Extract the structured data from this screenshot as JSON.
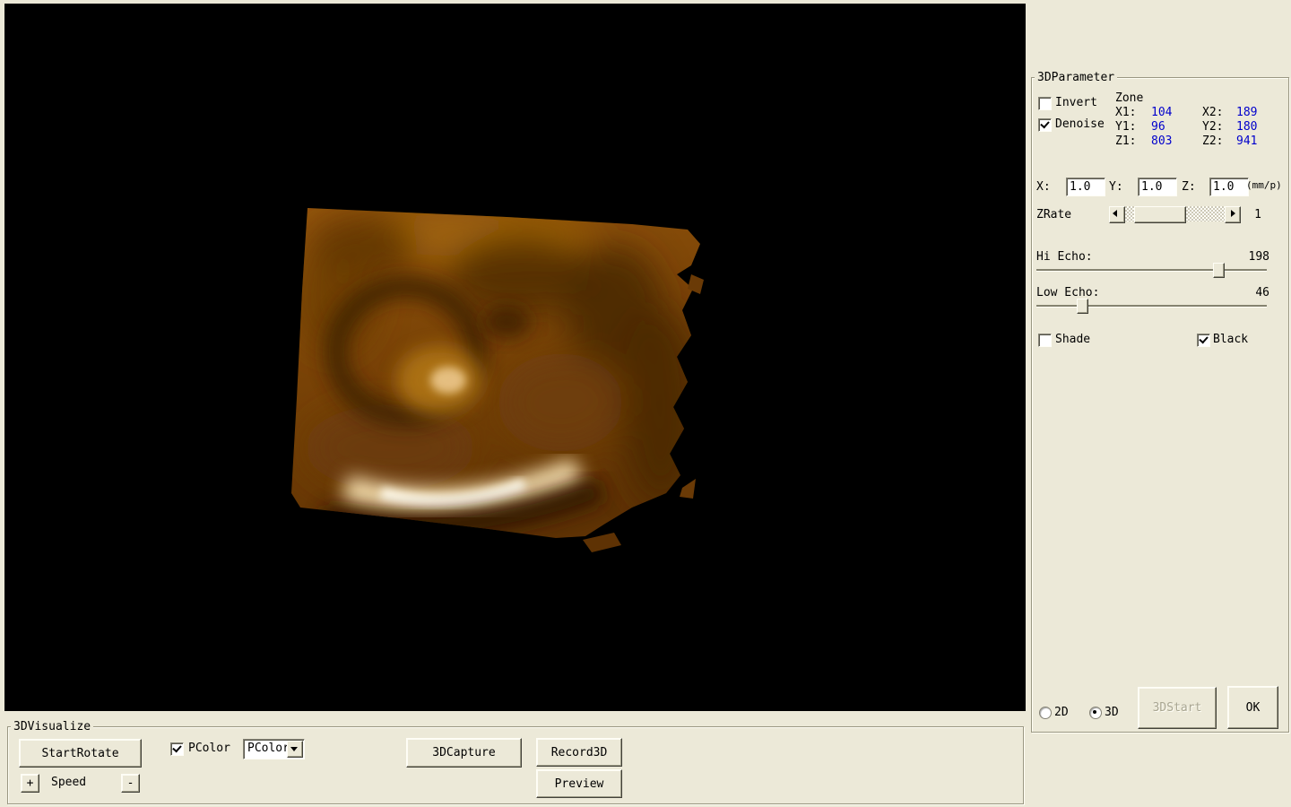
{
  "colors": {
    "window_bg": "#ece9d8",
    "viewport_bg": "#000000",
    "value_blue": "#0000cc",
    "volume_base": "#7c4507",
    "volume_highlight": "#fdf8e8"
  },
  "param_panel": {
    "title": "3DParameter",
    "invert": {
      "label": "Invert",
      "checked": false
    },
    "denoise": {
      "label": "Denoise",
      "checked": true
    },
    "zone": {
      "title": "Zone",
      "x1_label": "X1:",
      "x1_value": "104",
      "x2_label": "X2:",
      "x2_value": "189",
      "y1_label": "Y1:",
      "y1_value": "96",
      "y2_label": "Y2:",
      "y2_value": "180",
      "z1_label": "Z1:",
      "z1_value": "803",
      "z2_label": "Z2:",
      "z2_value": "941"
    },
    "scale": {
      "x_label": "X:",
      "x_value": "1.0",
      "y_label": "Y:",
      "y_value": "1.0",
      "z_label": "Z:",
      "z_value": "1.0",
      "unit": "(mm/p)"
    },
    "zrate": {
      "label": "ZRate",
      "value": "1"
    },
    "hi_echo": {
      "label": "Hi Echo:",
      "value": "198"
    },
    "low_echo": {
      "label": "Low Echo:",
      "value": "46"
    },
    "shade": {
      "label": "Shade",
      "checked": false
    },
    "black": {
      "label": "Black",
      "checked": true
    },
    "mode_2d": {
      "label": "2D",
      "selected": false
    },
    "mode_3d": {
      "label": "3D",
      "selected": true
    },
    "start3d_label": "3DStart",
    "ok_label": "OK"
  },
  "visualize_panel": {
    "title": "3DVisualize",
    "start_rotate_label": "StartRotate",
    "pcolor": {
      "label": "PColor",
      "checked": true
    },
    "pcolor_combo": {
      "value": "PColor"
    },
    "capture_label": "3DCapture",
    "record_label": "Record3D",
    "preview_label": "Preview",
    "speed": {
      "plus": "+",
      "label": "Speed",
      "minus": "-"
    }
  }
}
